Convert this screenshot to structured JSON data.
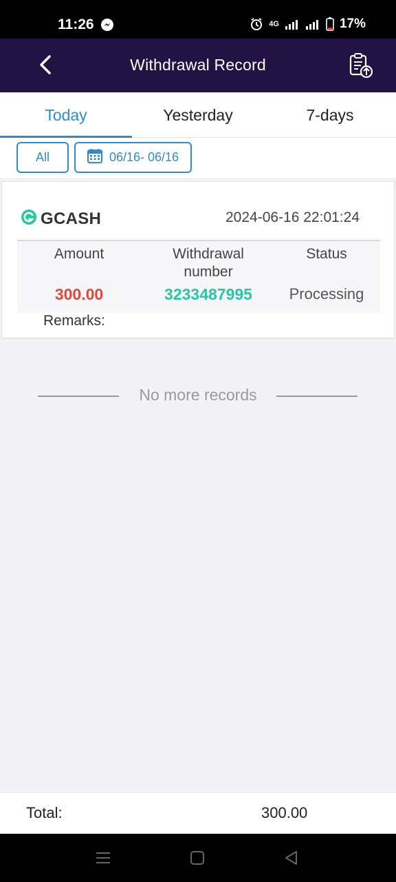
{
  "status_bar": {
    "time": "11:26",
    "network": "4G",
    "battery": "17%"
  },
  "header": {
    "title": "Withdrawal Record"
  },
  "tabs": [
    {
      "label": "Today",
      "active": true
    },
    {
      "label": "Yesterday",
      "active": false
    },
    {
      "label": "7-days",
      "active": false
    }
  ],
  "filters": {
    "type_label": "All",
    "date_range": "06/16- 06/16"
  },
  "record": {
    "method": "GCASH",
    "datetime": "2024-06-16 22:01:24",
    "amount_label": "Amount",
    "number_label_1": "Withdrawal",
    "number_label_2": "number",
    "status_label": "Status",
    "amount": "300.00",
    "number": "3233487995",
    "status": "Processing",
    "remarks_label": "Remarks:"
  },
  "list_end": "No more records",
  "footer": {
    "total_label": "Total:",
    "total_value": "300.00"
  },
  "colors": {
    "header_bg": "#221344",
    "accent": "#2e8bd0",
    "amount": "#e0483a",
    "number": "#27c6a5",
    "gcash": "#27c6a5"
  },
  "icons": {
    "back": "chevron-left-icon",
    "export": "clipboard-upload-icon",
    "calendar": "calendar-icon",
    "gcash": "gcash-logo-icon"
  }
}
